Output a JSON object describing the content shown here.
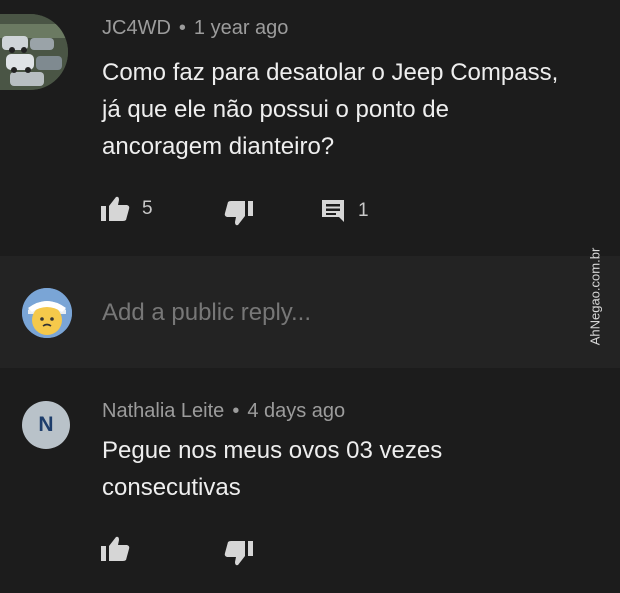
{
  "comment1": {
    "author": "JC4WD",
    "separator": "•",
    "time": "1 year ago",
    "text_line1": "Como faz para desatolar o Jeep Compass,",
    "text_line2": "já que ele não possui o ponto de",
    "text_line3": "ancoragem dianteiro?",
    "likes": "5",
    "replies": "1"
  },
  "reply_box": {
    "placeholder": "Add a public reply..."
  },
  "comment2": {
    "avatar_letter": "N",
    "author": "Nathalia Leite",
    "separator": "•",
    "time": "4 days ago",
    "text_line1": "Pegue nos meus ovos 03 vezes",
    "text_line2": "consecutivas"
  },
  "watermark": "AhNegao.com.br",
  "icons": {
    "like": "thumbs-up-icon",
    "dislike": "thumbs-down-icon",
    "reply": "comment-icon"
  }
}
